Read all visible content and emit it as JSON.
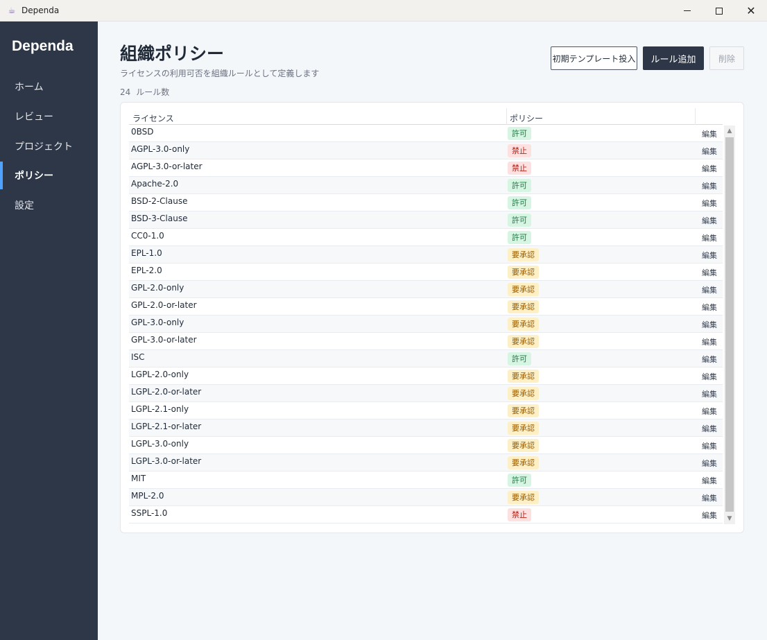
{
  "window": {
    "title": "Dependa",
    "icon": "app-icon"
  },
  "sidebar": {
    "brand": "Dependa",
    "items": [
      {
        "label": "ホーム",
        "active": false
      },
      {
        "label": "レビュー",
        "active": false
      },
      {
        "label": "プロジェクト",
        "active": false
      },
      {
        "label": "ポリシー",
        "active": true
      },
      {
        "label": "設定",
        "active": false
      }
    ]
  },
  "header": {
    "title": "組織ポリシー",
    "subtitle": "ライセンスの利用可否を組織ルールとして定義します",
    "rule_count_value": "24",
    "rule_count_label": "ルール数"
  },
  "toolbar": {
    "template_label": "初期テンプレート投入",
    "add_label": "ルール追加",
    "delete_label": "削除"
  },
  "table": {
    "columns": {
      "license": "ライセンス",
      "policy": "ポリシー"
    },
    "edit_label": "編集",
    "rows": [
      {
        "license": "0BSD",
        "policy": "許可",
        "kind": "allow"
      },
      {
        "license": "AGPL-3.0-only",
        "policy": "禁止",
        "kind": "deny"
      },
      {
        "license": "AGPL-3.0-or-later",
        "policy": "禁止",
        "kind": "deny"
      },
      {
        "license": "Apache-2.0",
        "policy": "許可",
        "kind": "allow"
      },
      {
        "license": "BSD-2-Clause",
        "policy": "許可",
        "kind": "allow"
      },
      {
        "license": "BSD-3-Clause",
        "policy": "許可",
        "kind": "allow"
      },
      {
        "license": "CC0-1.0",
        "policy": "許可",
        "kind": "allow"
      },
      {
        "license": "EPL-1.0",
        "policy": "要承認",
        "kind": "approve"
      },
      {
        "license": "EPL-2.0",
        "policy": "要承認",
        "kind": "approve"
      },
      {
        "license": "GPL-2.0-only",
        "policy": "要承認",
        "kind": "approve"
      },
      {
        "license": "GPL-2.0-or-later",
        "policy": "要承認",
        "kind": "approve"
      },
      {
        "license": "GPL-3.0-only",
        "policy": "要承認",
        "kind": "approve"
      },
      {
        "license": "GPL-3.0-or-later",
        "policy": "要承認",
        "kind": "approve"
      },
      {
        "license": "ISC",
        "policy": "許可",
        "kind": "allow"
      },
      {
        "license": "LGPL-2.0-only",
        "policy": "要承認",
        "kind": "approve"
      },
      {
        "license": "LGPL-2.0-or-later",
        "policy": "要承認",
        "kind": "approve"
      },
      {
        "license": "LGPL-2.1-only",
        "policy": "要承認",
        "kind": "approve"
      },
      {
        "license": "LGPL-2.1-or-later",
        "policy": "要承認",
        "kind": "approve"
      },
      {
        "license": "LGPL-3.0-only",
        "policy": "要承認",
        "kind": "approve"
      },
      {
        "license": "LGPL-3.0-or-later",
        "policy": "要承認",
        "kind": "approve"
      },
      {
        "license": "MIT",
        "policy": "許可",
        "kind": "allow"
      },
      {
        "license": "MPL-2.0",
        "policy": "要承認",
        "kind": "approve"
      },
      {
        "license": "SSPL-1.0",
        "policy": "禁止",
        "kind": "deny"
      }
    ]
  },
  "colors": {
    "sidebar_bg": "#2d3748",
    "active_indicator": "#4da3ff",
    "primary_button": "#2d3748",
    "allow": "#1f7a45",
    "deny": "#b42318",
    "approve": "#9a5b00"
  }
}
